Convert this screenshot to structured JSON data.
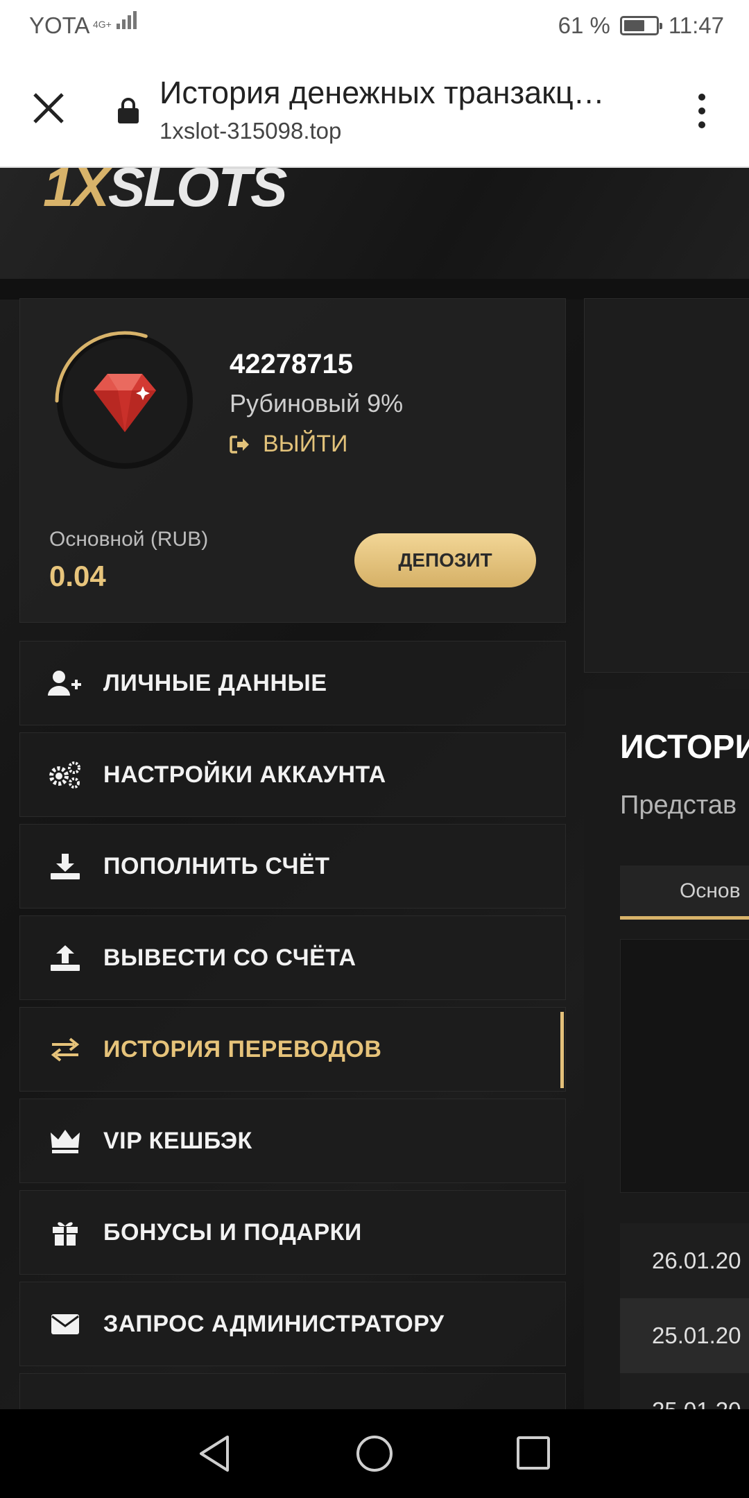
{
  "status_bar": {
    "carrier": "YOTA",
    "network": "4G+",
    "battery": "61 %",
    "time": "11:47"
  },
  "browser": {
    "page_title": "История денежных транзакц…",
    "url": "1xslot-315098.top"
  },
  "site": {
    "logo_part1": "1X",
    "logo_part2": "SLOTS"
  },
  "profile": {
    "user_id": "42278715",
    "level": "Рубиновый 9%",
    "level_progress": 0.09,
    "logout_label": "ВЫЙТИ",
    "balance_label": "Основной (RUB)",
    "balance_value": "0.04",
    "deposit_label": "ДЕПОЗИТ"
  },
  "menu": {
    "items": [
      {
        "label": "ЛИЧНЫЕ ДАННЫЕ",
        "icon": "user-plus-icon"
      },
      {
        "label": "НАСТРОЙКИ АККАУНТА",
        "icon": "gears-icon"
      },
      {
        "label": "ПОПОЛНИТЬ СЧЁТ",
        "icon": "download-icon"
      },
      {
        "label": "ВЫВЕСТИ СО СЧЁТА",
        "icon": "upload-icon"
      },
      {
        "label": "ИСТОРИЯ ПЕРЕВОДОВ",
        "icon": "exchange-icon",
        "active": true
      },
      {
        "label": "VIP КЕШБЭК",
        "icon": "crown-icon"
      },
      {
        "label": "БОНУСЫ И ПОДАРКИ",
        "icon": "gift-icon"
      },
      {
        "label": "ЗАПРОС АДМИНИСТРАТОРУ",
        "icon": "envelope-icon"
      }
    ]
  },
  "history_panel": {
    "title": "ИСТОРИ",
    "subtitle": "Представ",
    "tab_label": "Основ",
    "rows": [
      "26.01.20",
      "25.01.20",
      "25.01.20"
    ]
  },
  "colors": {
    "accent": "#E2C07A",
    "background": "#161616",
    "card": "#222222",
    "text": "#F2F2F2"
  }
}
